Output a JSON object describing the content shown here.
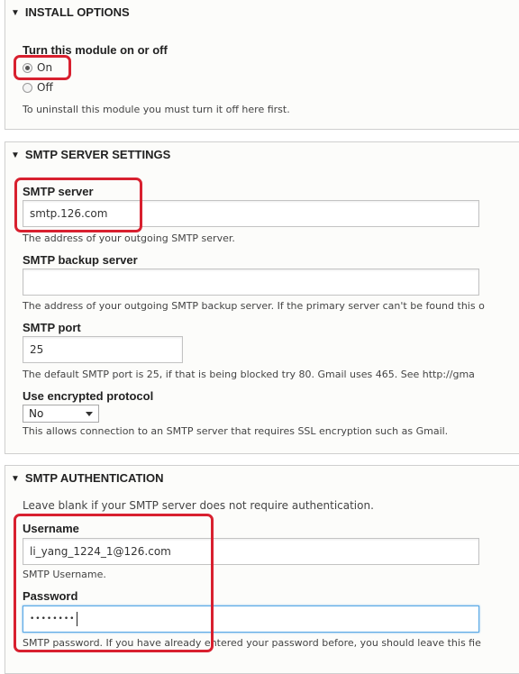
{
  "install_options": {
    "legend": "INSTALL OPTIONS",
    "field_label": "Turn this module on or off",
    "options": [
      {
        "label": "On",
        "checked": true
      },
      {
        "label": "Off",
        "checked": false
      }
    ],
    "description": "To uninstall this module you must turn it off here first."
  },
  "smtp_server_settings": {
    "legend": "SMTP SERVER SETTINGS",
    "server": {
      "label": "SMTP server",
      "value": "smtp.126.com",
      "description": "The address of your outgoing SMTP server."
    },
    "backup_server": {
      "label": "SMTP backup server",
      "value": "",
      "description": "The address of your outgoing SMTP backup server. If the primary server can't be found this o"
    },
    "port": {
      "label": "SMTP port",
      "value": "25",
      "description": "The default SMTP port is 25, if that is being blocked try 80. Gmail uses 465. See http://gma"
    },
    "protocol": {
      "label": "Use encrypted protocol",
      "selected": "No",
      "description": "This allows connection to an SMTP server that requires SSL encryption such as Gmail."
    }
  },
  "smtp_authentication": {
    "legend": "SMTP AUTHENTICATION",
    "intro": "Leave blank if your SMTP server does not require authentication.",
    "username": {
      "label": "Username",
      "value": "li_yang_1224_1@126.com",
      "description": "SMTP Username."
    },
    "password": {
      "label": "Password",
      "value": "••••••••",
      "description": "SMTP password. If you have already entered your password before, you should leave this fie"
    }
  },
  "colors": {
    "highlight": "#d8202f",
    "focus_border": "#5aa9e6"
  },
  "icons": {
    "collapse": "triangle-down-icon",
    "dropdown": "chevron-down-icon"
  }
}
